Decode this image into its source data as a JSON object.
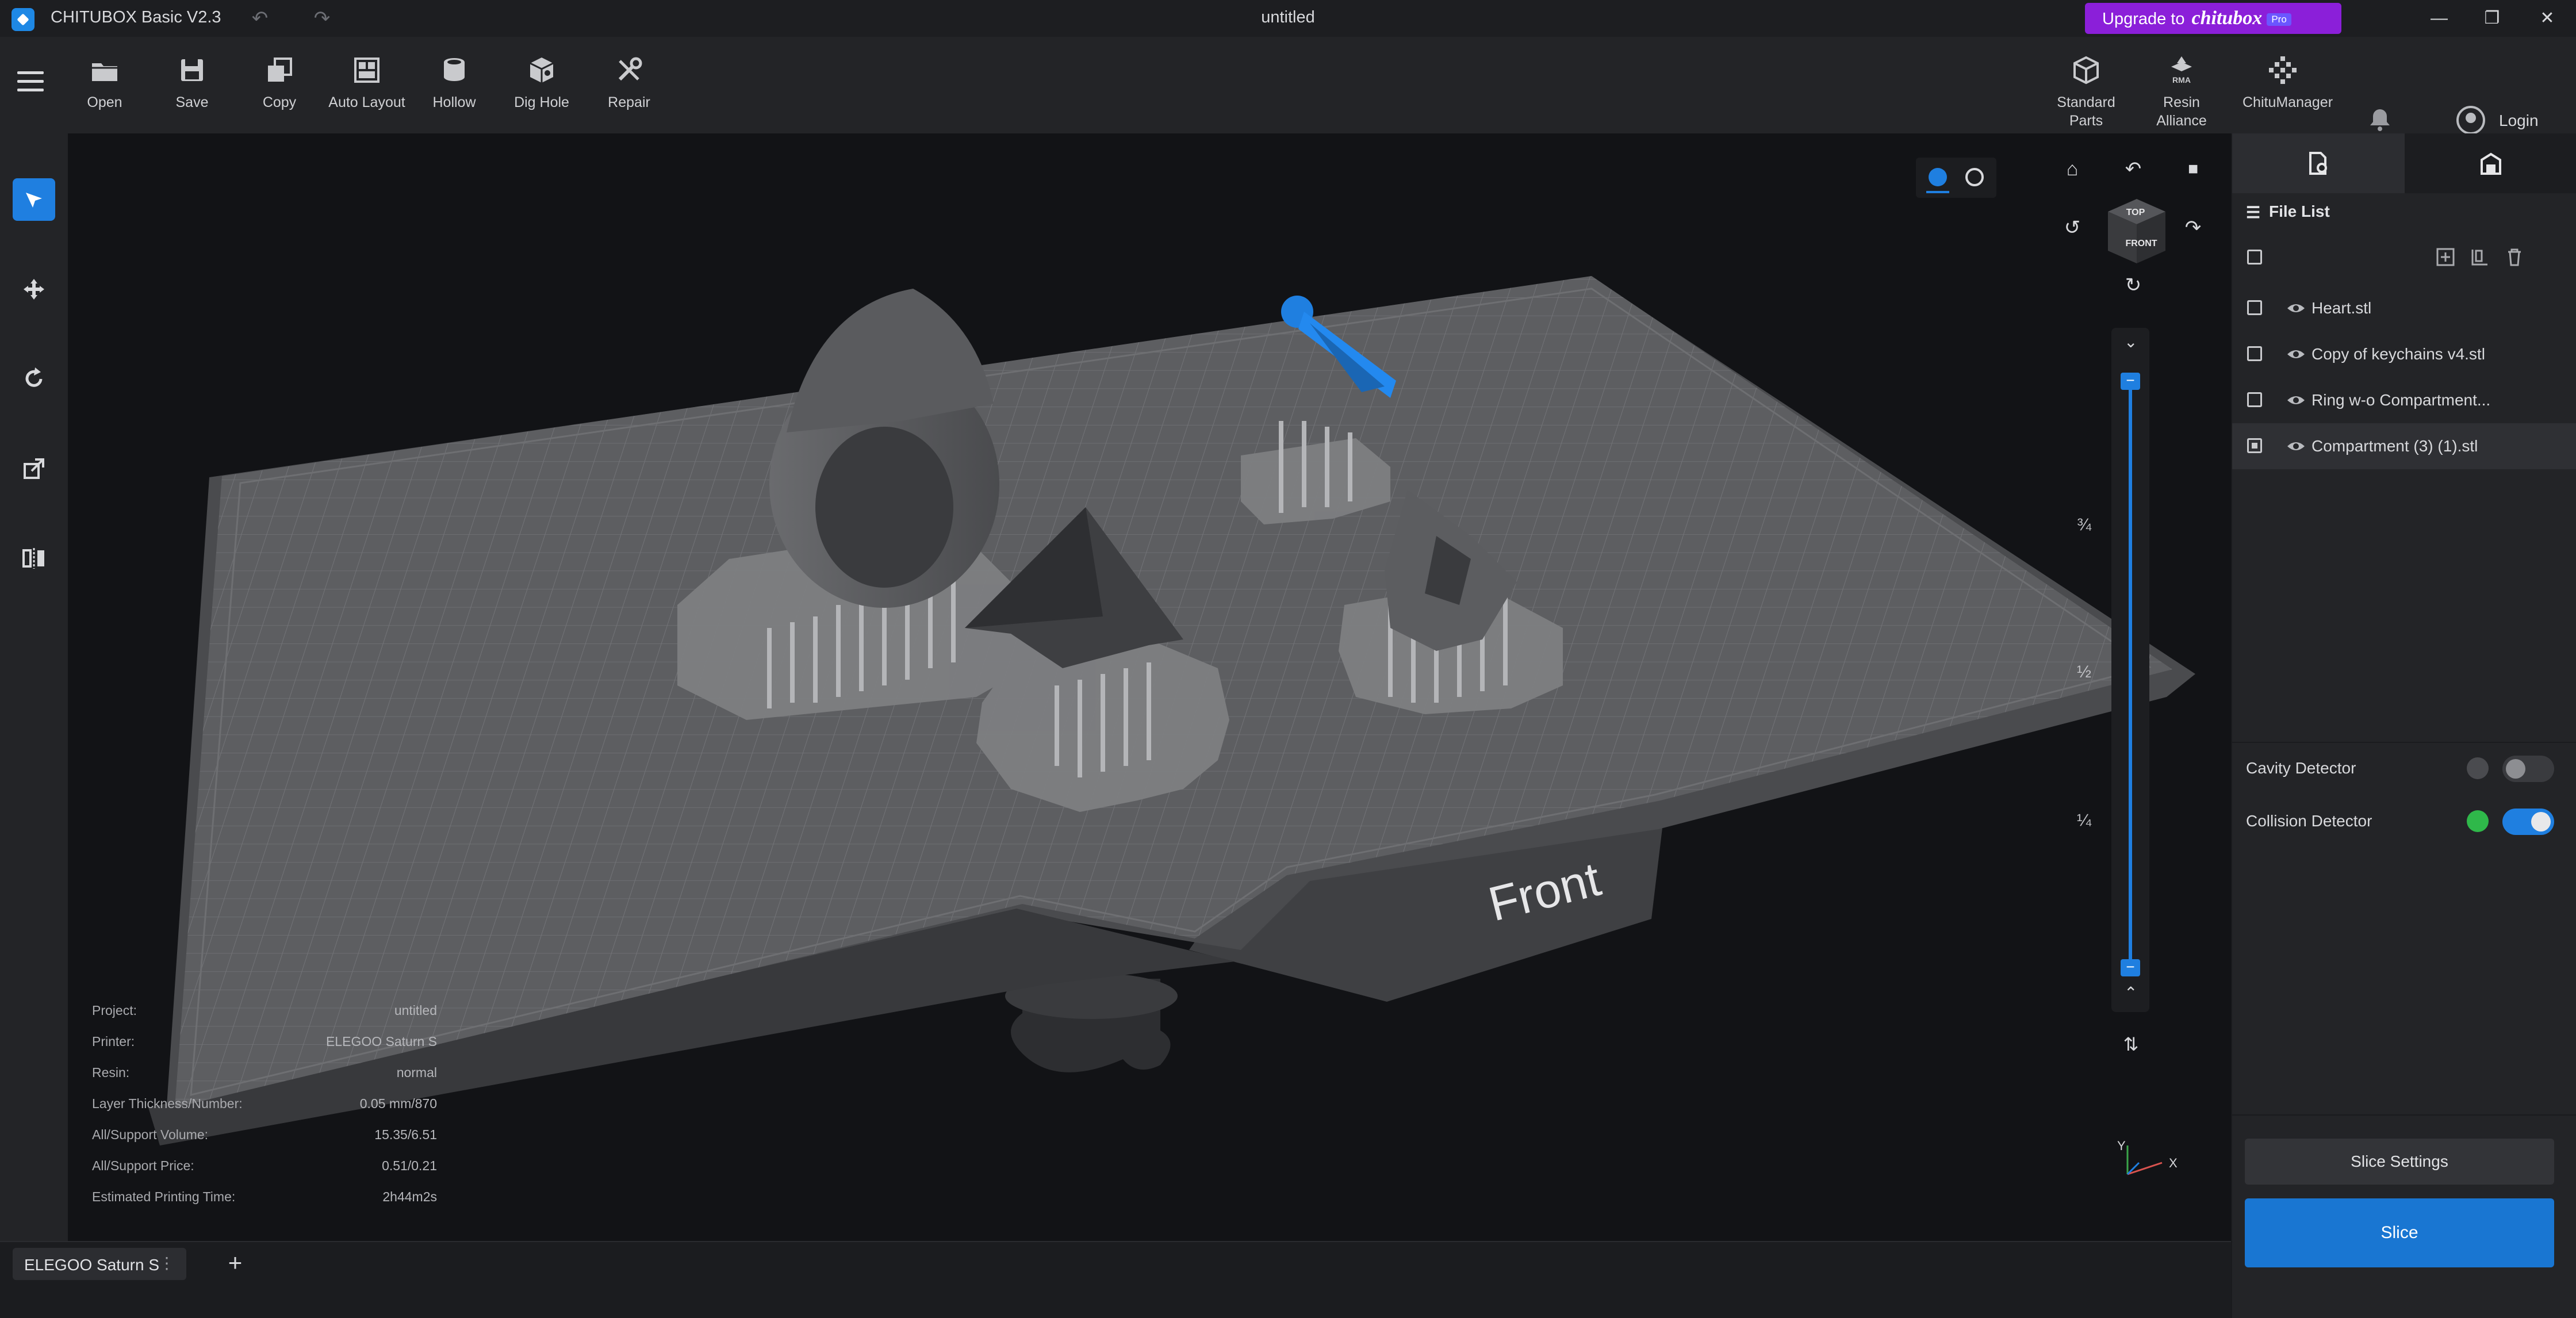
{
  "app": {
    "title": "CHITUBOX Basic V2.3",
    "document_title": "untitled",
    "upgrade_prefix": "Upgrade to",
    "upgrade_brand": "chitubox",
    "upgrade_badge": "Pro"
  },
  "toolbar": {
    "items": [
      {
        "label": "Open",
        "icon": "folder-icon"
      },
      {
        "label": "Save",
        "icon": "save-icon"
      },
      {
        "label": "Copy",
        "icon": "copy-icon"
      },
      {
        "label": "Auto Layout",
        "icon": "auto-layout-icon"
      },
      {
        "label": "Hollow",
        "icon": "hollow-icon"
      },
      {
        "label": "Dig Hole",
        "icon": "dig-hole-icon"
      },
      {
        "label": "Repair",
        "icon": "repair-icon"
      }
    ],
    "right_items": [
      {
        "label_line1": "Standard",
        "label_line2": "Parts",
        "icon": "standard-parts-icon"
      },
      {
        "label_line1": "Resin",
        "label_line2": "Alliance",
        "icon": "resin-alliance-icon"
      },
      {
        "label_line1": "ChituManager",
        "label_line2": "",
        "icon": "chitumanager-icon"
      }
    ],
    "login_label": "Login"
  },
  "left_rail": [
    "select-icon",
    "move-icon",
    "rotate-icon",
    "scale-icon",
    "mirror-icon"
  ],
  "file_panel": {
    "header": "File List",
    "files": [
      {
        "name": "Heart.stl",
        "checked": false
      },
      {
        "name": "Copy of keychains v4.stl",
        "checked": false
      },
      {
        "name": "Ring w-o Compartment...",
        "checked": false
      },
      {
        "name": "Compartment (3) (1).stl",
        "checked": true
      }
    ],
    "cavity_detector": {
      "label": "Cavity Detector",
      "enabled": false
    },
    "collision_detector": {
      "label": "Collision Detector",
      "enabled": true
    },
    "slice_settings_label": "Slice Settings",
    "slice_label": "Slice"
  },
  "viewport": {
    "plate_label": "Front",
    "view_cube_top": "TOP",
    "view_cube_front": "FRONT",
    "slider_fractions": [
      "¾",
      "½",
      "¼"
    ],
    "axis_x": "X",
    "axis_y": "Y",
    "accent": "#1f7fe0"
  },
  "info": [
    {
      "key": "Project:",
      "value": "untitled"
    },
    {
      "key": "Printer:",
      "value": "ELEGOO Saturn S"
    },
    {
      "key": "Resin:",
      "value": "normal"
    },
    {
      "key": "Layer Thickness/Number:",
      "value": "0.05 mm/870"
    },
    {
      "key": "All/Support Volume:",
      "value": "15.35/6.51"
    },
    {
      "key": "All/Support Price:",
      "value": "0.51/0.21"
    },
    {
      "key": "Estimated Printing Time:",
      "value": "2h44m2s"
    }
  ],
  "bottom_tabs": {
    "printer_tab": "ELEGOO Saturn S",
    "menu_glyph": "⋮",
    "add_glyph": "+"
  }
}
